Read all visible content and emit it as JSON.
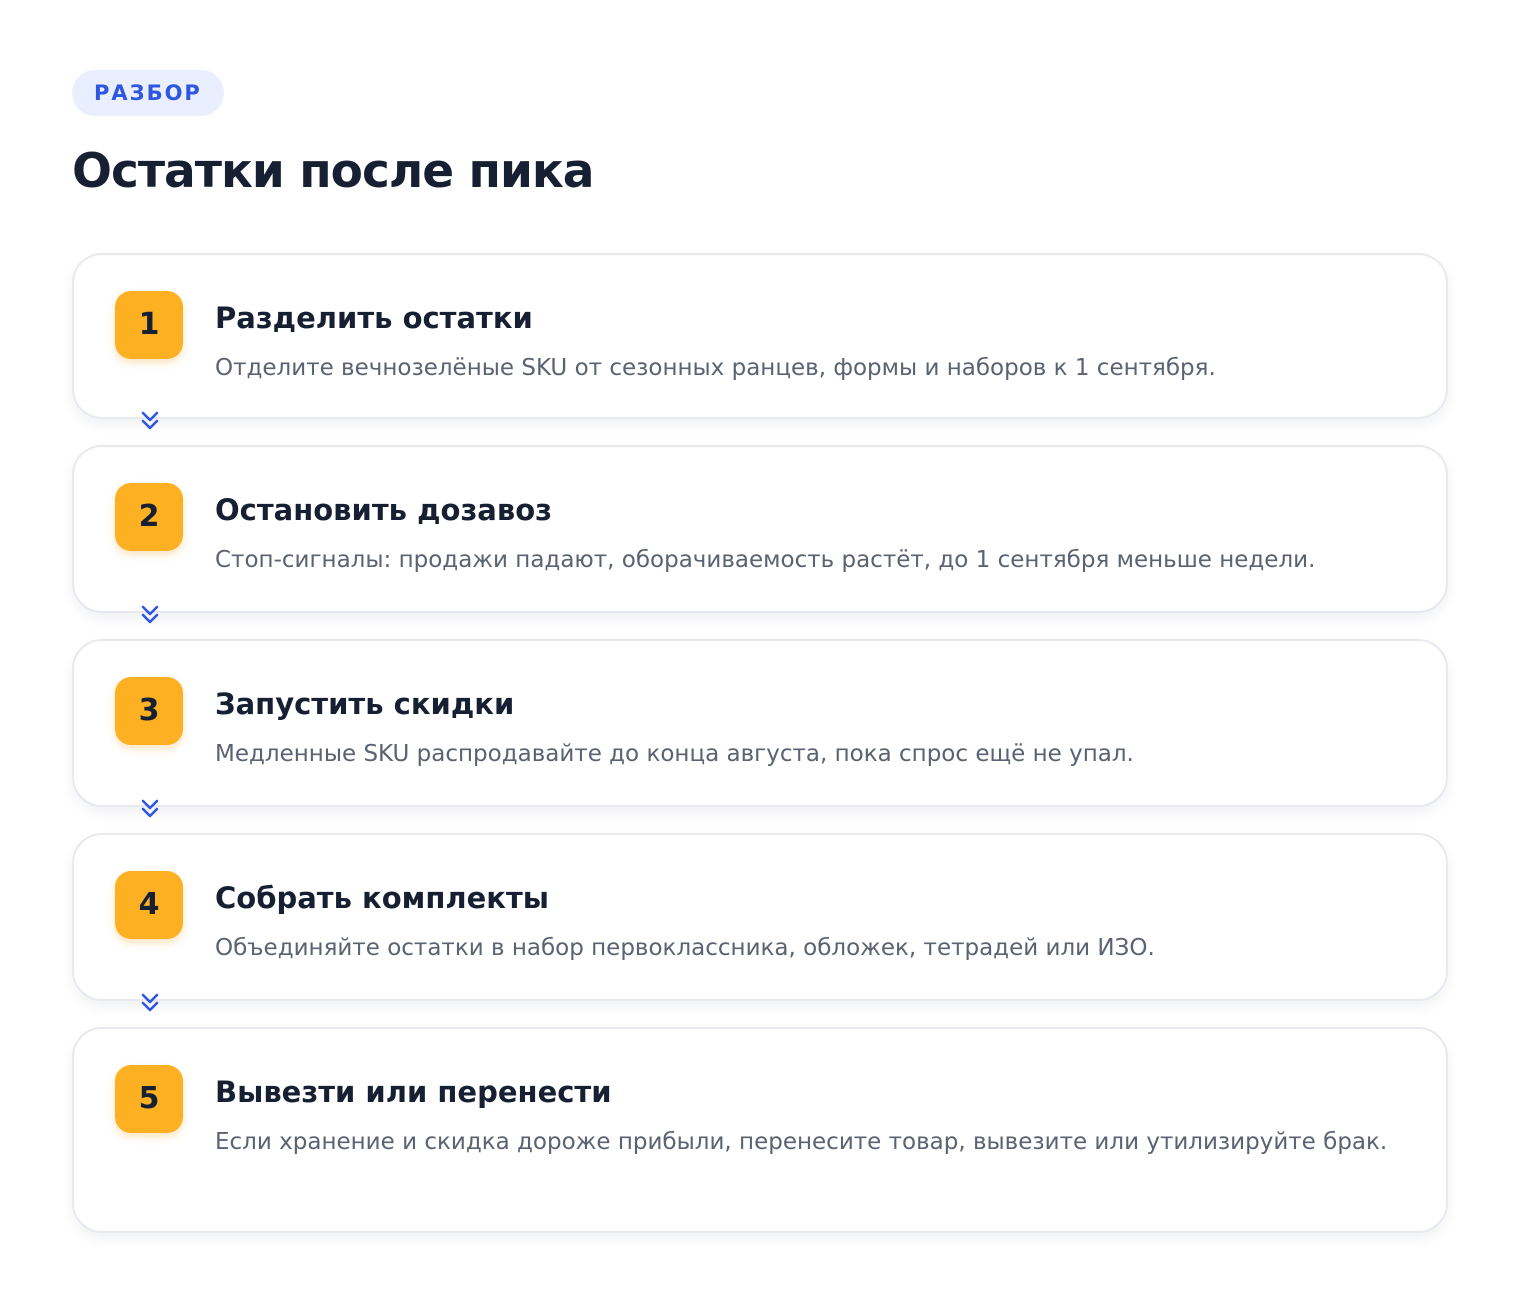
{
  "header": {
    "badge": "РАЗБОР",
    "title": "Остатки после пика"
  },
  "steps": [
    {
      "number": "1",
      "title": "Разделить остатки",
      "description": "Отделите вечнозелёные SKU от сезонных ранцев, формы и наборов к 1 сентября."
    },
    {
      "number": "2",
      "title": "Остановить дозавоз",
      "description": "Стоп-сигналы: продажи падают, оборачиваемость растёт, до 1 сентября меньше недели."
    },
    {
      "number": "3",
      "title": "Запустить скидки",
      "description": "Медленные SKU распродавайте до конца августа, пока спрос ещё не упал."
    },
    {
      "number": "4",
      "title": "Собрать комплекты",
      "description": "Объединяйте остатки в набор первоклассника, обложек, тетрадей или ИЗО."
    },
    {
      "number": "5",
      "title": "Вывезти или перенести",
      "description": "Если хранение и скидка дороже прибыли, перенесите товар, вывезите или утилизируйте брак."
    }
  ],
  "connector_icon": "double-chevron-down-icon",
  "colors": {
    "accent": "#2f56e0",
    "badge_bg": "#e9efff",
    "number_bg": "#fdb022",
    "title_text": "#172033",
    "desc_text": "#5b6271",
    "card_border": "#e7e9ef"
  }
}
